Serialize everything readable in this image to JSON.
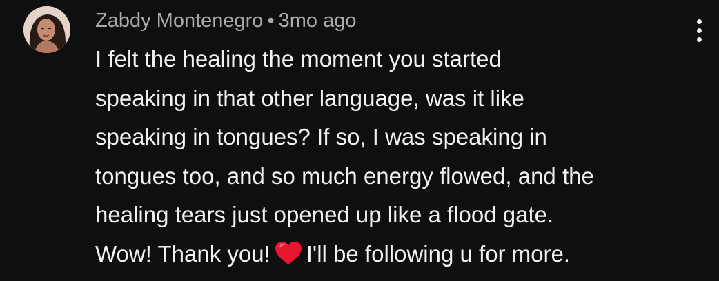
{
  "comment": {
    "author": "Zabdy Montenegro",
    "separator": "•",
    "time": "3mo ago",
    "lines": [
      "I felt the healing the moment you started",
      "speaking in that other language, was it like",
      "speaking in tongues? If so, I was speaking in",
      "tongues too, and so much energy flowed, and the",
      "healing tears just opened up like a flood gate."
    ],
    "last_line_before": "Wow! Thank you!",
    "last_line_after": "I'll be following u for more.",
    "emoji": "heart-emoji"
  },
  "icons": {
    "menu": "vertical-ellipsis-icon"
  },
  "colors": {
    "background": "#0f0f0f",
    "text_primary": "#f1f1f1",
    "text_secondary": "#aaaaaa",
    "heart": "#e8162f"
  }
}
